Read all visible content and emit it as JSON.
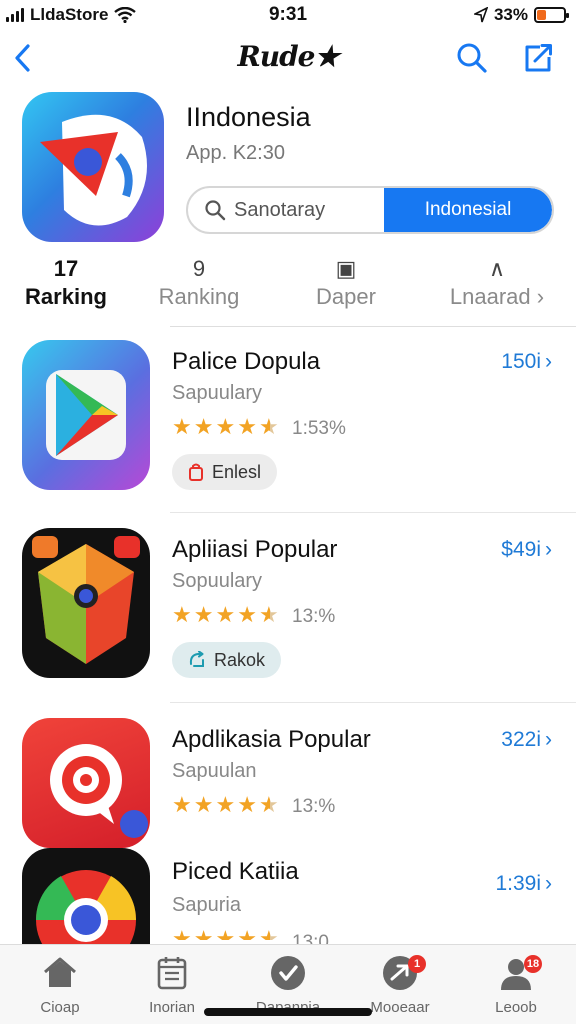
{
  "status_bar": {
    "carrier": "LldaStore",
    "time": "9:31",
    "battery": "33%",
    "battery_level": 0.33,
    "battery_color": "#f06a1c"
  },
  "nav": {
    "title": "Rude★",
    "back_icon": "chevron-left-icon",
    "search_icon": "search-icon",
    "share_icon": "share-icon"
  },
  "app": {
    "name": "IIndonesia",
    "subtitle": "App. K2:30",
    "search_placeholder": "Sanotaray",
    "segment_active": "Indonesial"
  },
  "tabs": [
    {
      "icon": "17",
      "label": "Rarking"
    },
    {
      "icon": "9",
      "label": "Ranking"
    },
    {
      "icon": "▣",
      "label": "Daper"
    },
    {
      "icon": "∧",
      "label": "Lnaarad"
    }
  ],
  "apps": [
    {
      "title": "Palice Dopula",
      "subtitle": "Sapuulary",
      "rating": 4.5,
      "count": "1:53%",
      "price": "150i",
      "button": "Enlesl"
    },
    {
      "title": "Apliiasi Popular",
      "subtitle": "Sopuulary",
      "rating": 4.5,
      "count": "13:%",
      "price": "$49i",
      "button": "Rakok"
    },
    {
      "title": "Apdlikasia Popular",
      "subtitle": "Sapuulan",
      "rating": 4.5,
      "count": "13:%",
      "price": "322i",
      "button": ""
    },
    {
      "title": "Piced Katiia",
      "subtitle": "Sapuria",
      "rating": 4.5,
      "count": "13:0",
      "price": "1:39i",
      "button": ""
    }
  ],
  "bottom_tabs": [
    {
      "label": "Cioap",
      "icon": "home-icon",
      "badge": ""
    },
    {
      "label": "Inorian",
      "icon": "calendar-icon",
      "badge": ""
    },
    {
      "label": "Dapanpia",
      "icon": "checkmark-icon",
      "badge": ""
    },
    {
      "label": "Mooeaar",
      "icon": "arrow-icon",
      "badge": "1"
    },
    {
      "label": "Leoob",
      "icon": "person-icon",
      "badge": "18"
    }
  ],
  "colors": {
    "accent": "#1778f2",
    "price": "#1f7ad6",
    "star": "#f2a324"
  }
}
